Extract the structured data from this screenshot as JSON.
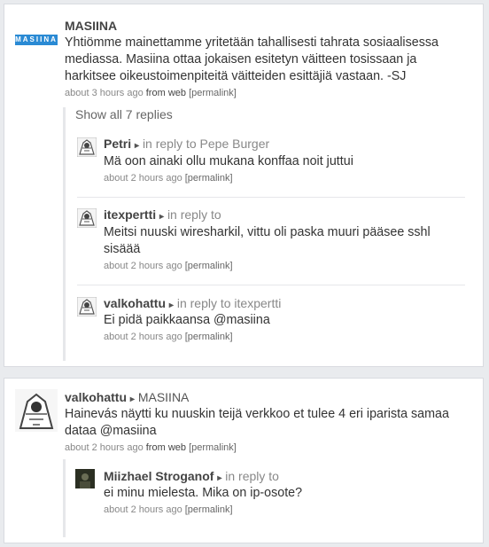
{
  "post1": {
    "author": "MASIINA",
    "logo_text": "MASIINA",
    "text": "Yhtiömme mainettamme yritetään tahallisesti tahrata sosiaalisessa mediassa. Masiina ottaa jokaisen esitetyn väitteen tosissaan ja harkitsee oikeustoimenpiteitä väitteiden esittäjiä vastaan. -SJ",
    "time": "about 3 hours ago",
    "from_label": "from",
    "source": "web",
    "permalink": "[permalink]",
    "show_all": "Show all 7 replies",
    "replies": [
      {
        "author": "Petri",
        "in_reply_label": "in reply to",
        "target": "Pepe Burger",
        "text": "Mä oon ainaki ollu mukana konffaa noit juttui",
        "time": "about 2 hours ago",
        "permalink": "[permalink]"
      },
      {
        "author": "itexpertti",
        "in_reply_label": "in reply to",
        "target": "",
        "text": "Meitsi nuuski wiresharkil, vittu oli paska muuri pääsee sshl sisäää",
        "time": "about 2 hours ago",
        "permalink": "[permalink]"
      },
      {
        "author": "valkohattu",
        "in_reply_label": "in reply to",
        "target": "itexpertti",
        "text": "Ei pidä paikkaansa @masiina",
        "time": "about 2 hours ago",
        "permalink": "[permalink]"
      }
    ]
  },
  "post2": {
    "author": "valkohattu",
    "target": "MASIINA",
    "text": "Hainevás näytti ku nuuskin teijä verkkoo et tulee 4 eri iparista samaa dataa @masiina",
    "time": "about 2 hours ago",
    "from_label": "from",
    "source": "web",
    "permalink": "[permalink]",
    "replies": [
      {
        "author": "Miizhael Stroganof",
        "in_reply_label": "in reply to",
        "target": "",
        "text": "ei minu mielesta. Mika on ip-osote?",
        "time": "about 2 hours ago",
        "permalink": "[permalink]"
      }
    ]
  },
  "arrow_glyph": "▸"
}
